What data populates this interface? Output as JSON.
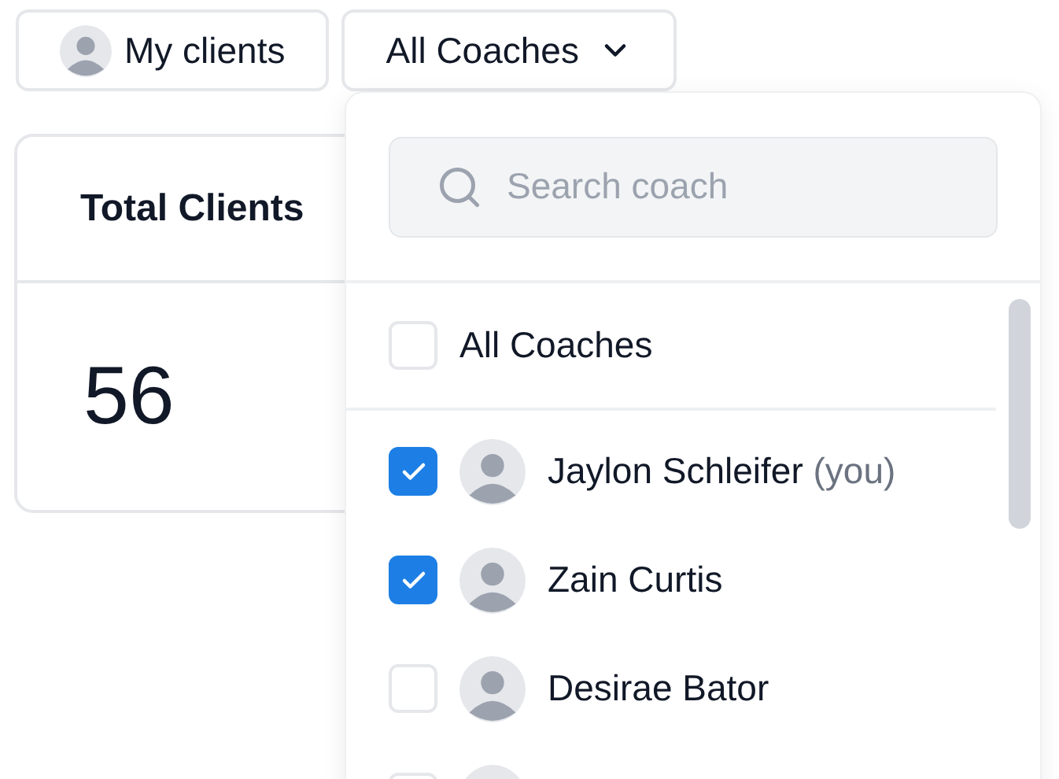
{
  "filters": [
    {
      "kind": "avatar",
      "label": "My clients"
    },
    {
      "kind": "dropdown",
      "label": "All Coaches"
    }
  ],
  "card": {
    "title": "Total Clients",
    "value": "56"
  },
  "dropdown": {
    "search": {
      "placeholder": "Search coach"
    },
    "all_option": {
      "label": "All Coaches",
      "checked": false
    },
    "coaches": [
      {
        "name": "Jaylon Schleifer",
        "suffix": "(you)",
        "checked": true
      },
      {
        "name": "Zain Curtis",
        "checked": true
      },
      {
        "name": "Desirae Bator",
        "checked": false
      },
      {
        "checked": false
      }
    ]
  }
}
